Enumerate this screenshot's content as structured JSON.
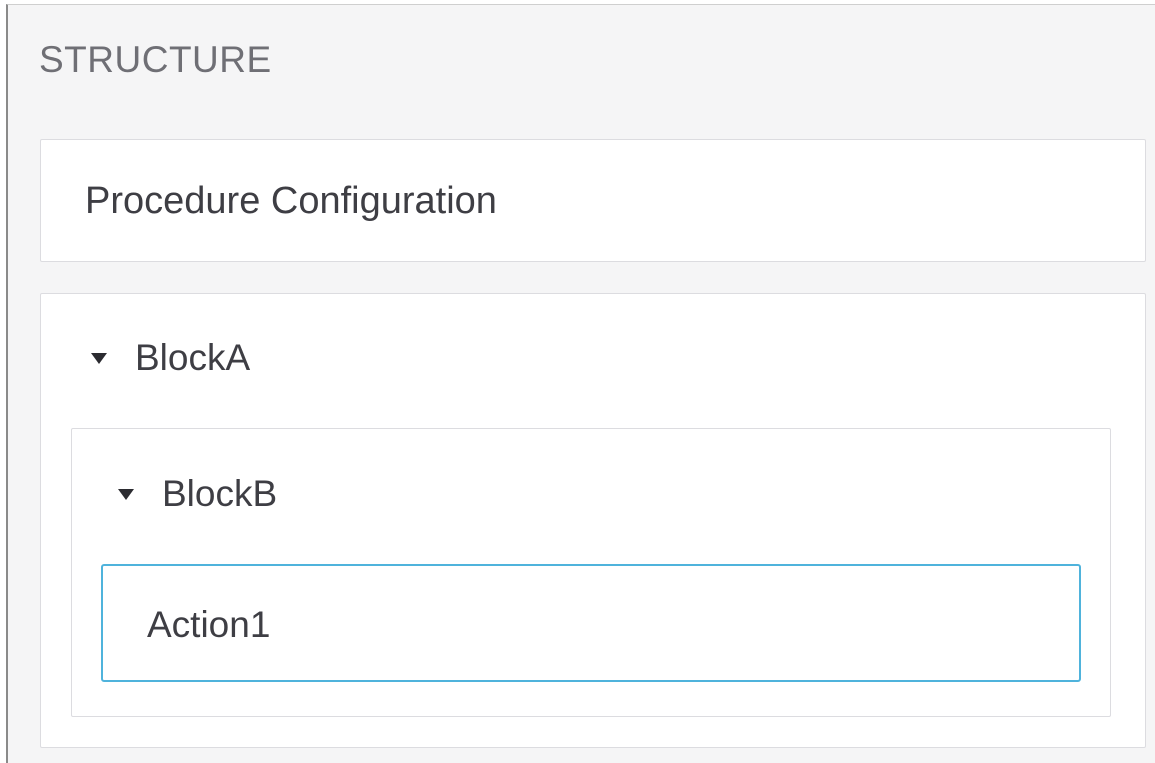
{
  "structure": {
    "title": "STRUCTURE",
    "procedure_configuration": "Procedure Configuration",
    "block_a": {
      "label": "BlockA",
      "expanded": true,
      "block_b": {
        "label": "BlockB",
        "expanded": true,
        "actions": [
          {
            "label": "Action1",
            "selected": true
          }
        ]
      }
    }
  },
  "colors": {
    "panel_background": "#f5f5f6",
    "card_border": "#dcdce0",
    "selection_border": "#4fb3dc",
    "title_text": "#6f6f75",
    "body_text": "#3e3e44"
  },
  "icons": {
    "expand_caret": "caret-down-icon"
  }
}
